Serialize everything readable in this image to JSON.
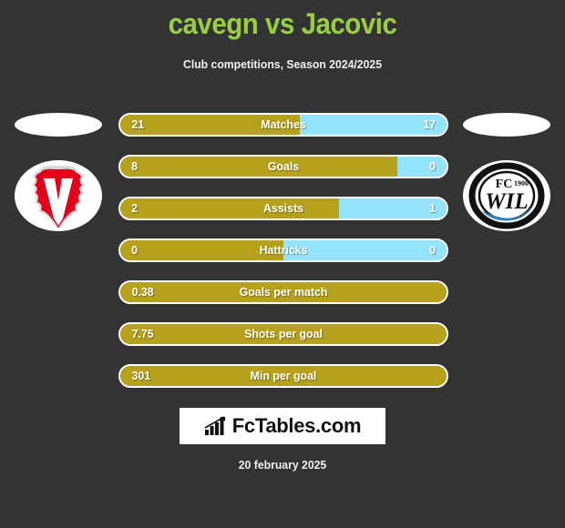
{
  "header": {
    "title": "cavegn vs Jacovic",
    "subtitle": "Club competitions, Season 2024/2025",
    "title_color": "#9ACD42"
  },
  "teams": {
    "home": {
      "logo_name": "fc-vaduz-crest",
      "logo_alt": "FC Vaduz"
    },
    "away": {
      "logo_name": "fc-wil-1900-crest",
      "logo_alt": "FC Wil 1900",
      "text_top": "FC",
      "text_year": "1900",
      "text_main": "WIL"
    }
  },
  "colors": {
    "home_bar": "#B5A11C",
    "away_bar": "#93E3FB",
    "background": "#333333",
    "bar_border": "#ffffff"
  },
  "stats": [
    {
      "label": "Matches",
      "home": "21",
      "away": "17",
      "home_pct": 55,
      "type": "compare"
    },
    {
      "label": "Goals",
      "home": "8",
      "away": "0",
      "home_pct": 85,
      "type": "compare"
    },
    {
      "label": "Assists",
      "home": "2",
      "away": "1",
      "home_pct": 67,
      "type": "compare"
    },
    {
      "label": "Hattricks",
      "home": "0",
      "away": "0",
      "home_pct": 50,
      "type": "compare"
    },
    {
      "label": "Goals per match",
      "home": "0.38",
      "away": "",
      "home_pct": 100,
      "type": "single"
    },
    {
      "label": "Shots per goal",
      "home": "7.75",
      "away": "",
      "home_pct": 100,
      "type": "single"
    },
    {
      "label": "Min per goal",
      "home": "301",
      "away": "",
      "home_pct": 100,
      "type": "single"
    }
  ],
  "footer": {
    "brand": "FcTables.com",
    "brand_icon": "bar-chart-trend-icon",
    "date": "20 february 2025"
  }
}
